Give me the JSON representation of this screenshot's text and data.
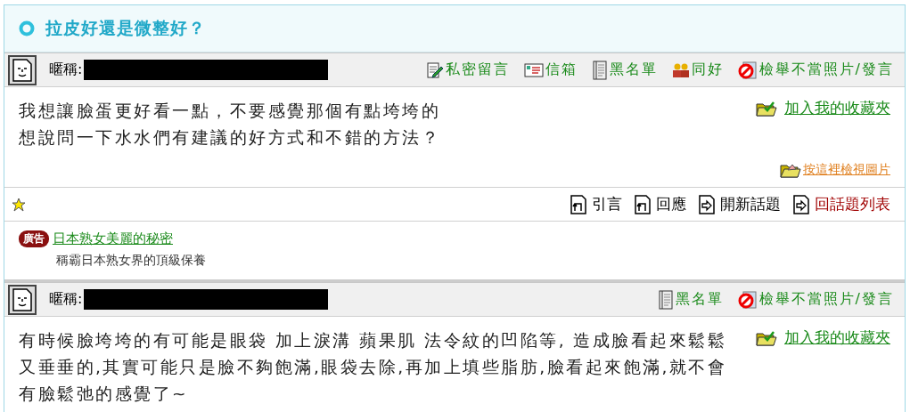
{
  "topic": {
    "title": "拉皮好還是微整好？"
  },
  "posts": [
    {
      "nickname_label": "暱稱:",
      "actions": [
        {
          "kind": "private-message",
          "label": "私密留言"
        },
        {
          "kind": "mailbox",
          "label": "信箱"
        },
        {
          "kind": "blacklist",
          "label": "黑名單"
        },
        {
          "kind": "friends",
          "label": "同好"
        },
        {
          "kind": "report",
          "label": "檢舉不當照片/發言"
        }
      ],
      "body": [
        "我想讓臉蛋更好看一點，不要感覺那個有點垮垮的",
        "想說問一下水水們有建議的好方式和不錯的方法？"
      ],
      "favorite": "加入我的收藏夾",
      "view_photos": "按這裡檢視圖片",
      "footer_actions": [
        {
          "kind": "quote",
          "label": "引言"
        },
        {
          "kind": "reply",
          "label": "回應"
        },
        {
          "kind": "new-topic",
          "label": "開新話題"
        },
        {
          "kind": "topic-list",
          "label": "回話題列表"
        }
      ]
    },
    {
      "nickname_label": "暱稱:",
      "actions": [
        {
          "kind": "blacklist",
          "label": "黑名單"
        },
        {
          "kind": "report",
          "label": "檢舉不當照片/發言"
        }
      ],
      "body": [
        "有時候臉垮垮的有可能是眼袋 加上淚溝 蘋果肌 法令紋的凹陷等, 造成臉看起來鬆鬆",
        "又垂垂的,其實可能只是臉不夠飽滿,眼袋去除,再加上填些脂肪,臉看起來飽滿,就不會",
        "有臉鬆弛的感覺了~"
      ],
      "favorite": "加入我的收藏夾"
    }
  ],
  "ad": {
    "badge": "廣告",
    "title": "日本熟女美麗的秘密",
    "text": "稱霸日本熟女界的頂級保養"
  }
}
